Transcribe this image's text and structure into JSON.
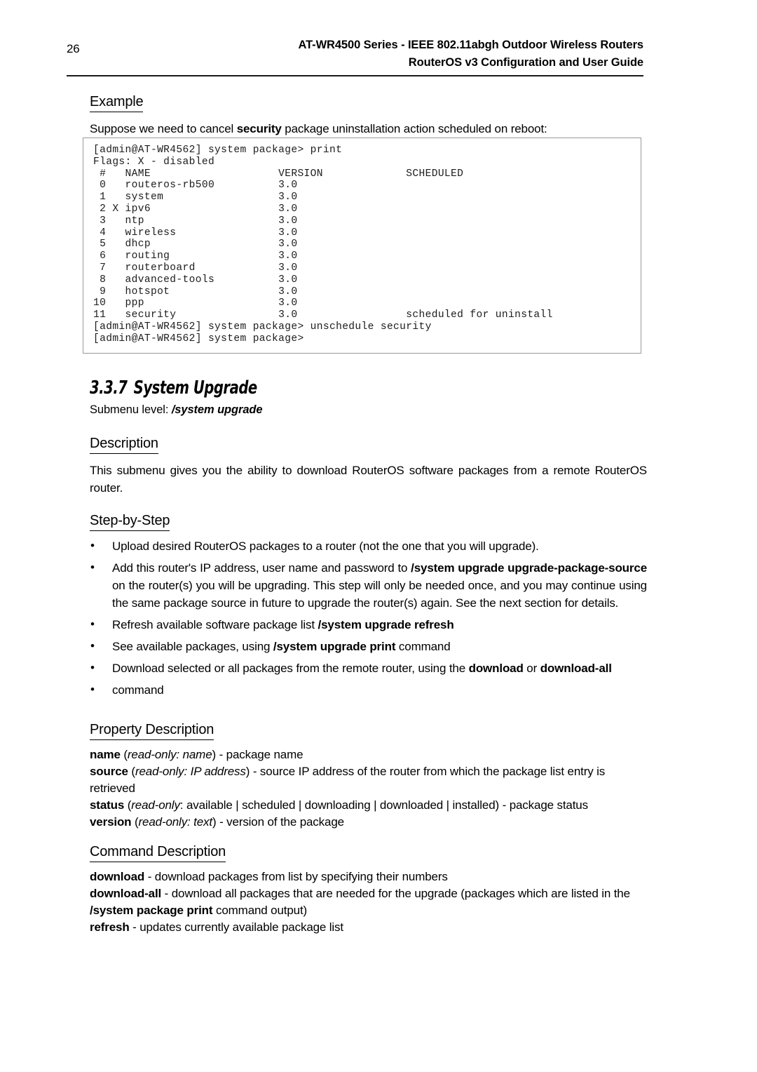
{
  "header": {
    "page_number": "26",
    "line1": "AT-WR4500 Series - IEEE 802.11abgh Outdoor Wireless Routers",
    "line2": "RouterOS v3 Configuration and User Guide"
  },
  "example": {
    "heading": "Example",
    "intro_pre": "Suppose we need to cancel ",
    "intro_bold": "security",
    "intro_post": " package uninstallation action scheduled on reboot:",
    "terminal": "[admin@AT-WR4562] system package> print\nFlags: X - disabled\n #   NAME                    VERSION             SCHEDULED\n 0   routeros-rb500          3.0\n 1   system                  3.0\n 2 X ipv6                    3.0\n 3   ntp                     3.0\n 4   wireless                3.0\n 5   dhcp                    3.0\n 6   routing                 3.0\n 7   routerboard             3.0\n 8   advanced-tools          3.0\n 9   hotspot                 3.0\n10   ppp                     3.0\n11   security                3.0                 scheduled for uninstall\n[admin@AT-WR4562] system package> unschedule security\n[admin@AT-WR4562] system package>"
  },
  "section": {
    "number": "3.3.7",
    "title": "System Upgrade",
    "submenu_label": "Submenu level: ",
    "submenu_path": "/system upgrade"
  },
  "description": {
    "heading": "Description",
    "text": "This submenu gives you the ability to download RouterOS software packages from a remote RouterOS router."
  },
  "step_by_step": {
    "heading": "Step-by-Step",
    "items": [
      {
        "parts": [
          {
            "text": "Upload desired RouterOS packages to a router (not the one that you will upgrade).",
            "style": "normal"
          }
        ]
      },
      {
        "parts": [
          {
            "text": "Add this router's IP address, user name and password to ",
            "style": "normal"
          },
          {
            "text": "/system upgrade upgrade-package-source",
            "style": "bold"
          },
          {
            "text": " on the router(s) you will be upgrading. This step will only be needed once, and you may continue using the same package source in future to upgrade the router(s) again. See the next section for details.",
            "style": "normal"
          }
        ]
      },
      {
        "parts": [
          {
            "text": "Refresh available software package list ",
            "style": "normal"
          },
          {
            "text": "/system upgrade refresh",
            "style": "bold"
          }
        ]
      },
      {
        "parts": [
          {
            "text": "See available packages, using ",
            "style": "normal"
          },
          {
            "text": "/system upgrade print",
            "style": "bold"
          },
          {
            "text": " command",
            "style": "normal"
          }
        ]
      },
      {
        "parts": [
          {
            "text": "Download selected or all packages from the remote router, using the ",
            "style": "normal"
          },
          {
            "text": "download",
            "style": "bold"
          },
          {
            "text": " or ",
            "style": "normal"
          },
          {
            "text": "download-all",
            "style": "bold"
          }
        ]
      },
      {
        "parts": [
          {
            "text": "command",
            "style": "normal"
          }
        ]
      }
    ]
  },
  "property_description": {
    "heading": "Property Description",
    "properties": [
      {
        "parts": [
          {
            "text": "name",
            "style": "bold"
          },
          {
            "text": " (",
            "style": "normal"
          },
          {
            "text": "read-only: name",
            "style": "italic"
          },
          {
            "text": ") - package name",
            "style": "normal"
          }
        ]
      },
      {
        "parts": [
          {
            "text": "source",
            "style": "bold"
          },
          {
            "text": " (",
            "style": "normal"
          },
          {
            "text": "read-only: IP address",
            "style": "italic"
          },
          {
            "text": ") - source IP address of the router from which the package list entry is retrieved",
            "style": "normal"
          }
        ]
      },
      {
        "parts": [
          {
            "text": "status",
            "style": "bold"
          },
          {
            "text": " (",
            "style": "normal"
          },
          {
            "text": "read-only",
            "style": "italic"
          },
          {
            "text": ": available | scheduled | downloading | downloaded | installed) - package status",
            "style": "normal"
          }
        ]
      },
      {
        "parts": [
          {
            "text": "version",
            "style": "bold"
          },
          {
            "text": " (",
            "style": "normal"
          },
          {
            "text": "read-only: text",
            "style": "italic"
          },
          {
            "text": ") - version of the package",
            "style": "normal"
          }
        ]
      }
    ]
  },
  "command_description": {
    "heading": "Command Description",
    "commands": [
      {
        "parts": [
          {
            "text": "download",
            "style": "bold"
          },
          {
            "text": " - download packages from list by specifying their numbers",
            "style": "normal"
          }
        ]
      },
      {
        "parts": [
          {
            "text": "download-all",
            "style": "bold"
          },
          {
            "text": " - download all packages that are needed for the upgrade (packages which are listed in the ",
            "style": "normal"
          },
          {
            "text": "/system package print",
            "style": "bold"
          },
          {
            "text": " command output)",
            "style": "normal"
          }
        ]
      },
      {
        "parts": [
          {
            "text": "refresh",
            "style": "bold"
          },
          {
            "text": " - updates currently available package list",
            "style": "normal"
          }
        ]
      }
    ]
  }
}
